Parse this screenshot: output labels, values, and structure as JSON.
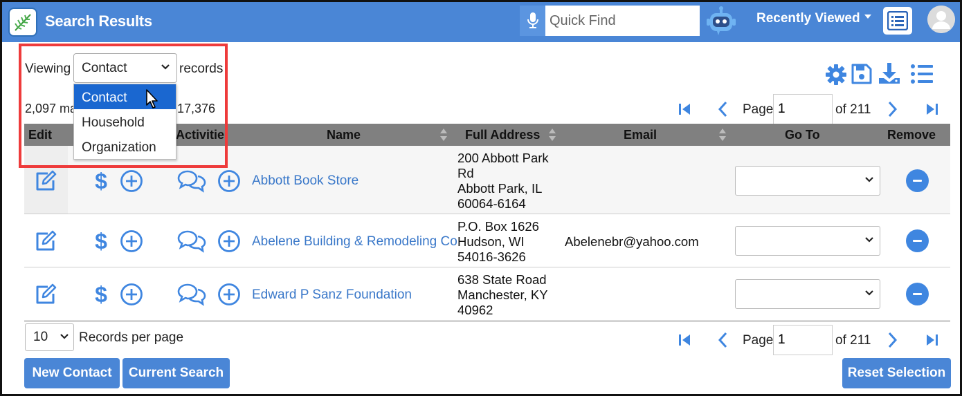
{
  "header": {
    "title": "Search Results",
    "quick_find_placeholder": "Quick Find",
    "recently_viewed": "Recently Viewed"
  },
  "viewing": {
    "label": "Viewing",
    "selected": "Contact",
    "suffix": "records",
    "options": [
      "Contact",
      "Household",
      "Organization"
    ],
    "count_prefix": "2,097 ma",
    "count_suffix": "17,376"
  },
  "pagination": {
    "page_label": "Page",
    "current_page": "1",
    "of_total": "of 211"
  },
  "table": {
    "headers": {
      "edit": "Edit",
      "activities": "Activitie",
      "name": "Name",
      "address": "Full Address",
      "email": "Email",
      "goto": "Go To",
      "remove": "Remove"
    },
    "rows": [
      {
        "name": "Abbott Book Store",
        "address": [
          "200 Abbott Park",
          "Rd",
          "Abbott Park, IL",
          "60064-6164"
        ],
        "email": ""
      },
      {
        "name": "Abelene Building & Remodeling Co",
        "address": [
          "P.O. Box 1626",
          "Hudson, WI",
          "54016-3626"
        ],
        "email": "Abelenebr@yahoo.com"
      },
      {
        "name": "Edward P Sanz Foundation",
        "address": [
          "638 State Road",
          "Manchester, KY",
          "40962"
        ],
        "email": ""
      }
    ]
  },
  "footer": {
    "per_page_value": "10",
    "per_page_label": "Records per page",
    "new_contact": "New Contact",
    "current_search": "Current Search",
    "reset_selection": "Reset Selection"
  },
  "colors": {
    "header_bg": "#4a86d6",
    "accent": "#3f86e0",
    "link": "#3a78c9",
    "dropdown_selected": "#1a67d0",
    "callout": "#ee3b3b"
  }
}
